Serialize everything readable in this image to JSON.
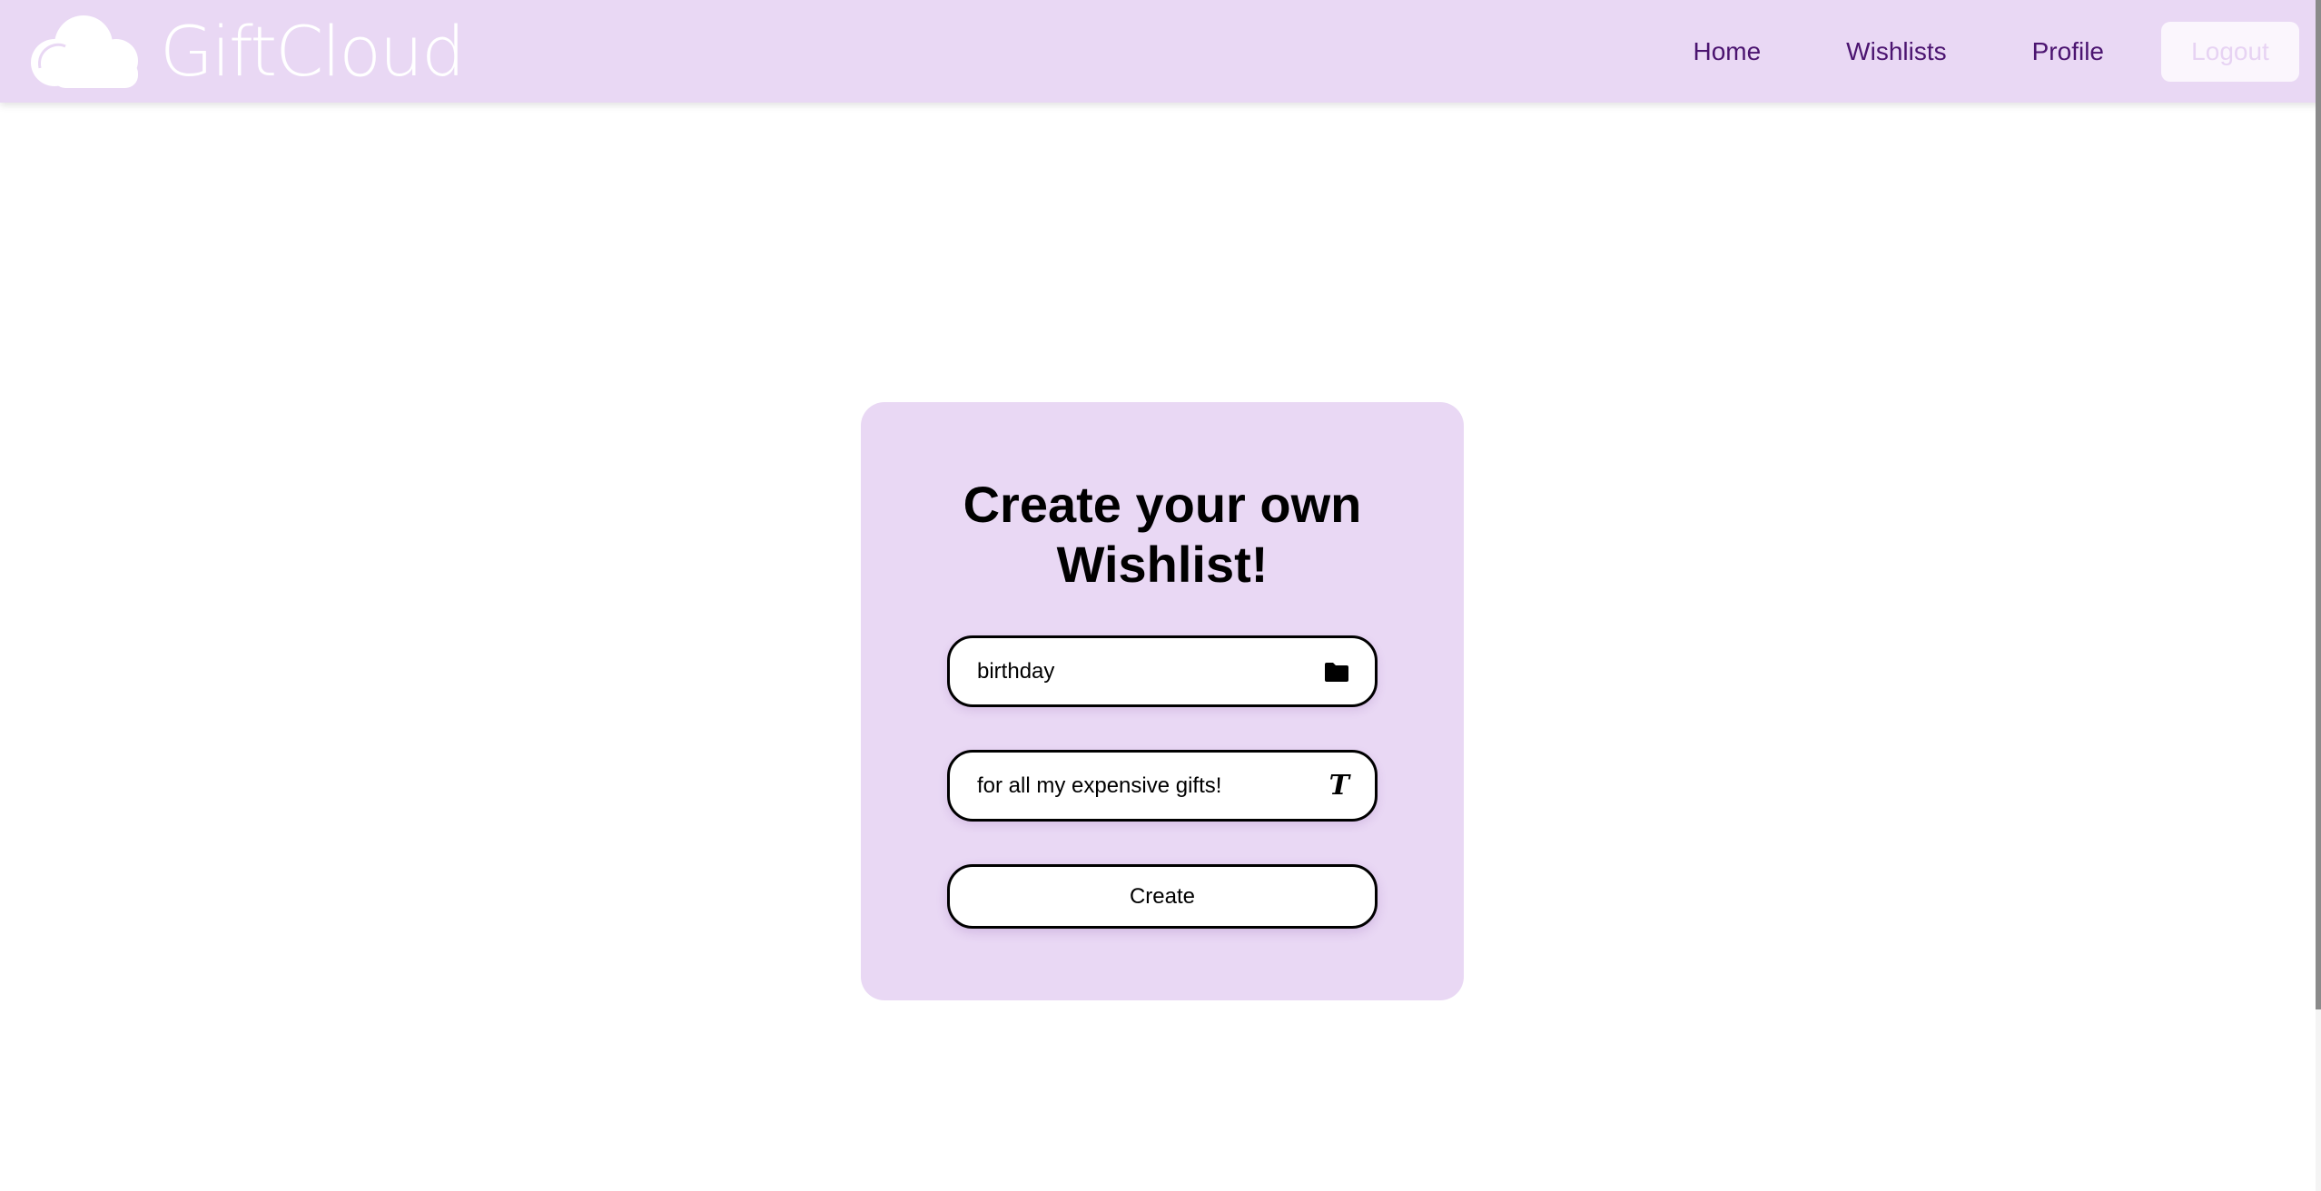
{
  "app": {
    "brand_name": "GiftCloud",
    "logo_icon": "cloud-icon",
    "accent_color": "#e9d8f4",
    "nav_text_color": "#4b1470"
  },
  "nav": {
    "links": [
      {
        "label": "Home"
      },
      {
        "label": "Wishlists"
      },
      {
        "label": "Profile"
      }
    ],
    "logout_label": "Logout"
  },
  "form": {
    "title": "Create your own Wishlist!",
    "name_field": {
      "value": "birthday",
      "icon": "folder-icon"
    },
    "description_field": {
      "value": "for all my expensive gifts!",
      "icon": "text-icon"
    },
    "submit_label": "Create"
  }
}
